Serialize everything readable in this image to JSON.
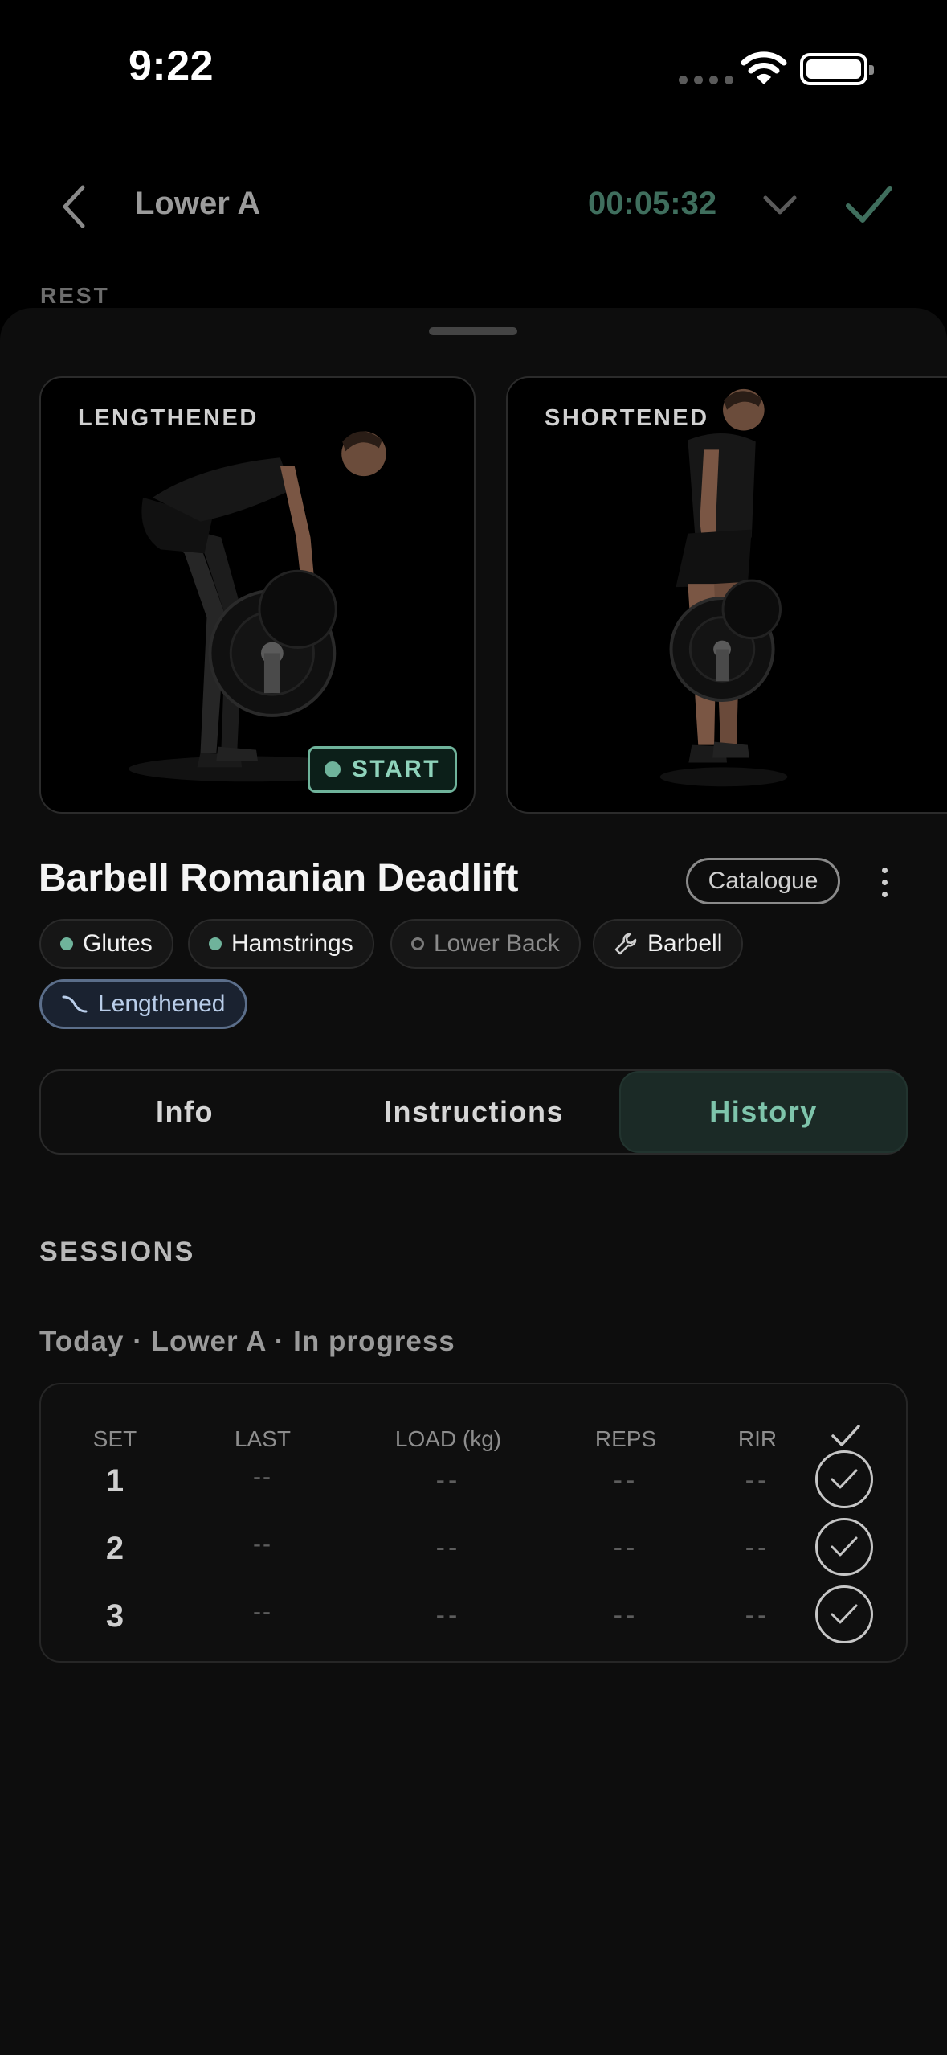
{
  "status_bar": {
    "time": "9:22"
  },
  "header": {
    "title": "Lower A",
    "timer": "00:05:32",
    "back_icon": "chevron-left-icon",
    "collapse_icon": "chevron-down-icon",
    "finish_icon": "checkmark-icon"
  },
  "rest_label": "REST",
  "positions": {
    "lengthened_label": "LENGTHENED",
    "shortened_label": "SHORTENED",
    "start_label": "START"
  },
  "exercise": {
    "title": "Barbell Romanian Deadlift",
    "catalogue_label": "Catalogue",
    "chips": {
      "glutes": "Glutes",
      "hamstrings": "Hamstrings",
      "lower_back": "Lower Back",
      "barbell": "Barbell",
      "lengthened": "Lengthened"
    }
  },
  "tabs": {
    "info": "Info",
    "instructions": "Instructions",
    "history": "History",
    "active": "History"
  },
  "history": {
    "sessions_label": "SESSIONS",
    "session_title": "Today · Lower A · In progress",
    "columns": {
      "set": "SET",
      "last": "LAST",
      "load": "LOAD (kg)",
      "reps": "REPS",
      "rir": "RIR"
    },
    "rows": [
      {
        "set": "1",
        "last": "--",
        "load": "--",
        "reps": "--",
        "rir": "--"
      },
      {
        "set": "2",
        "last": "--",
        "load": "--",
        "reps": "--",
        "rir": "--"
      },
      {
        "set": "3",
        "last": "--",
        "load": "--",
        "reps": "--",
        "rir": "--"
      }
    ]
  },
  "colors": {
    "accent": "#6fb39b",
    "timer": "#3f6e5d",
    "sheet_background": "#0d0d0d",
    "lengthened_chip": "#5b6e8a"
  }
}
